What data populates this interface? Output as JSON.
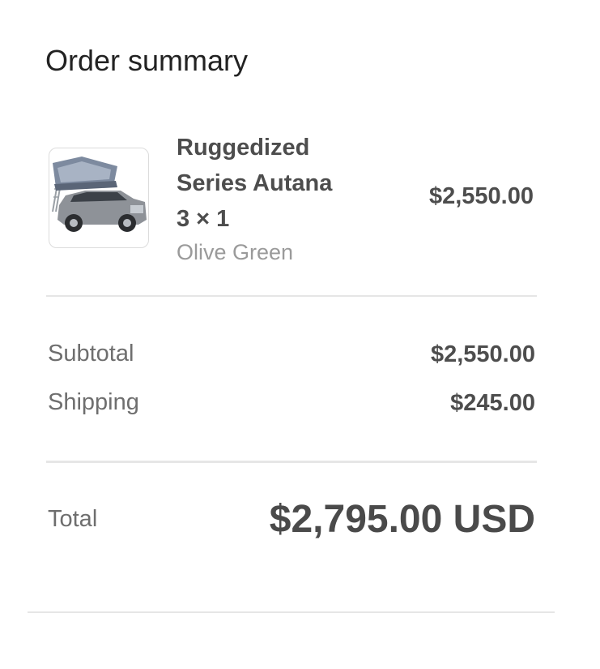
{
  "order_summary": {
    "title": "Order summary",
    "item": {
      "image_icon": "product-thumbnail-suv-with-roof-tent",
      "name": "Ruggedized Series Autana",
      "quantity_line": "3 × 1",
      "variant": "Olive Green",
      "price": "$2,550.00"
    },
    "subtotal": {
      "label": "Subtotal",
      "value": "$2,550.00"
    },
    "shipping": {
      "label": "Shipping",
      "value": "$245.00"
    },
    "total": {
      "label": "Total",
      "value": "$2,795.00 USD"
    }
  }
}
